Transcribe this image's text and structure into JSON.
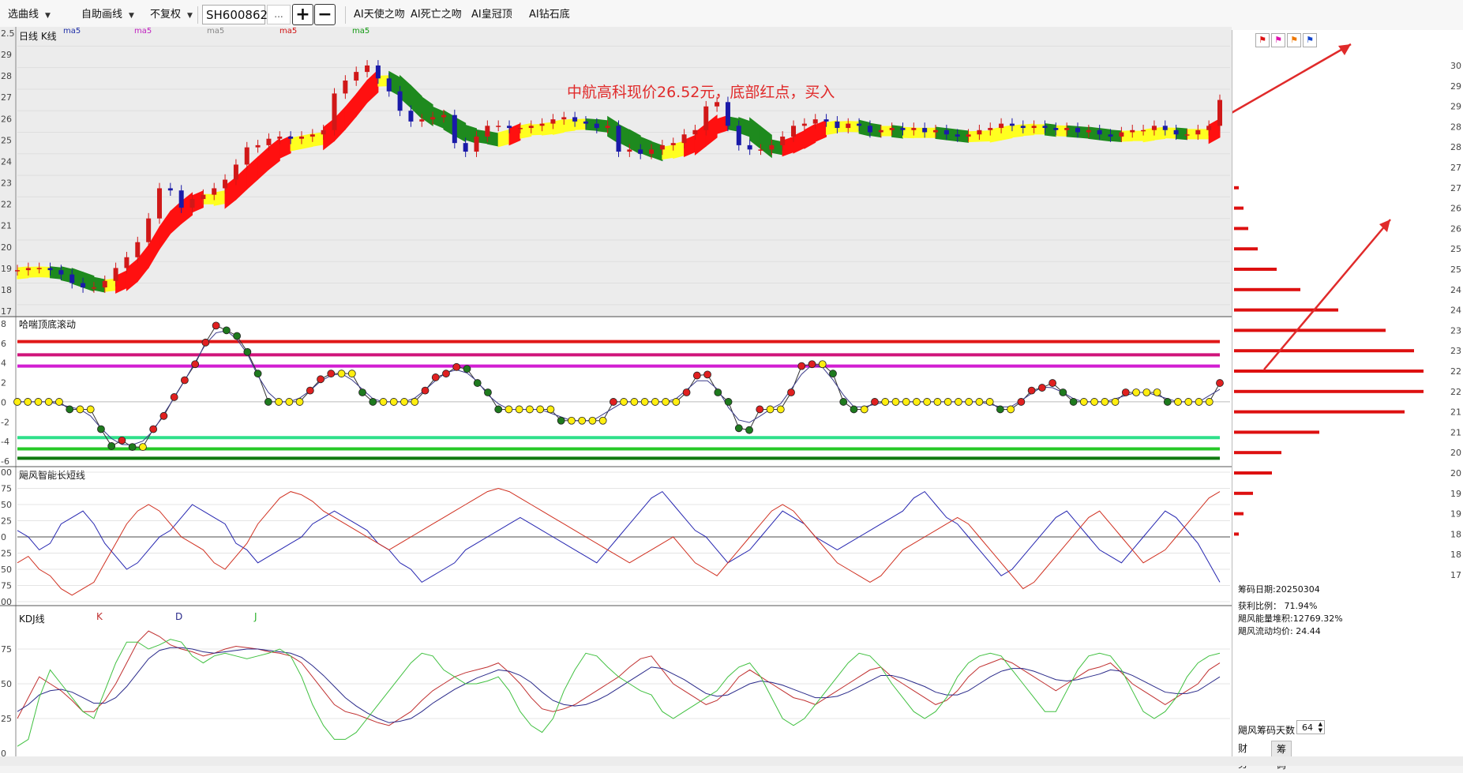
{
  "toolbar": {
    "draw_menu": "选曲线",
    "auto_draw": "自助画线",
    "adjust_mode": "不复权",
    "stock_code": "SH600862",
    "more": "...",
    "zoom_in": "+",
    "zoom_out": "−",
    "ai_buttons": [
      "AI天使之吻",
      "AI死亡之吻",
      "AI皇冠顶",
      "AI钻石底"
    ]
  },
  "annotation": "中航高科现价26.52元，底部红点，买入",
  "panels": {
    "kline": {
      "title": "日线 K线",
      "ma_labels": [
        {
          "text": "ma5",
          "color": "#1f2fa8"
        },
        {
          "text": "ma5",
          "color": "#c020c0"
        },
        {
          "text": "ma5",
          "color": "#888888"
        },
        {
          "text": "ma5",
          "color": "#d01010"
        },
        {
          "text": "ma5",
          "color": "#129a12"
        }
      ],
      "y_ticks": [
        "2.5",
        "29",
        "28",
        "27",
        "26",
        "25",
        "24",
        "23",
        "22",
        "21",
        "20",
        "19",
        "18",
        "17"
      ]
    },
    "hz": {
      "title": "哈喘顶底滚动",
      "y_ticks": [
        "8",
        "6",
        "4",
        "2",
        "0",
        "-2",
        "-4",
        "-6"
      ],
      "levels": [
        {
          "value": 6.4,
          "color": "#e01818"
        },
        {
          "value": 5.0,
          "color": "#d0147a"
        },
        {
          "value": 3.8,
          "color": "#d21ed2"
        },
        {
          "value": -3.8,
          "color": "#2fe08a"
        },
        {
          "value": -5.0,
          "color": "#27c827"
        },
        {
          "value": -6.0,
          "color": "#0f7a0f"
        }
      ]
    },
    "jf": {
      "title": "飓风智能长短线",
      "y_ticks": [
        "00",
        "75",
        "50",
        "25",
        "0",
        "25",
        "50",
        "75",
        "00"
      ]
    },
    "kdj": {
      "title": "KDJ线",
      "legend": [
        {
          "text": "K",
          "color": "#c03030"
        },
        {
          "text": "D",
          "color": "#2a2a8a"
        },
        {
          "text": "J",
          "color": "#28b028"
        }
      ],
      "y_ticks": [
        "75",
        "50",
        "25",
        "0"
      ]
    }
  },
  "chip": {
    "icons": [
      "flag-red-icon",
      "flag-pink-icon",
      "flag-orange-icon",
      "flag-blue-icon"
    ],
    "price_ticks": [
      "30",
      "29",
      "29",
      "28",
      "28",
      "27",
      "27",
      "26",
      "26",
      "25",
      "25",
      "24",
      "24",
      "23",
      "23",
      "22",
      "22",
      "21",
      "21",
      "20",
      "20",
      "19",
      "19",
      "18",
      "18",
      "17"
    ],
    "date_label": "筹码日期:20250304",
    "profit_label": "获利比例：",
    "profit_value": "71.94%",
    "energy_label": "飓风能量堆积:",
    "energy_value": "12769.32%",
    "avg_label": "飓风流动均价:",
    "avg_value": "24.44",
    "days_label": "飓风筹码天数",
    "days_value": "64",
    "tabs": [
      "财务",
      "筹码"
    ]
  },
  "chart_data": [
    {
      "type": "candlestick",
      "title": "日线 K线",
      "ylim": [
        16.7,
        29.6
      ],
      "x_count": 111,
      "close": [
        18.6,
        18.7,
        18.7,
        18.6,
        18.4,
        18.0,
        17.8,
        17.8,
        18.1,
        18.7,
        19.2,
        19.9,
        21.0,
        22.4,
        22.3,
        21.5,
        21.9,
        22.1,
        22.4,
        22.8,
        23.5,
        24.3,
        24.4,
        24.7,
        24.8,
        24.7,
        24.8,
        24.9,
        25.1,
        26.8,
        27.4,
        27.8,
        28.1,
        27.5,
        26.9,
        26.0,
        25.5,
        25.6,
        25.7,
        25.8,
        24.5,
        24.1,
        24.8,
        25.3,
        25.3,
        25.2,
        25.2,
        25.3,
        25.4,
        25.6,
        25.7,
        25.5,
        25.4,
        25.2,
        25.3,
        24.1,
        24.2,
        24.0,
        24.2,
        24.4,
        24.5,
        24.9,
        25.1,
        26.2,
        26.4,
        25.3,
        24.4,
        24.2,
        24.2,
        24.4,
        24.8,
        25.3,
        25.4,
        25.6,
        25.5,
        25.2,
        25.4,
        25.3,
        25.0,
        25.1,
        25.2,
        25.1,
        25.2,
        25.0,
        25.1,
        24.9,
        24.8,
        24.9,
        25.1,
        25.2,
        25.4,
        25.3,
        25.2,
        25.3,
        25.2,
        25.1,
        25.2,
        25.0,
        25.1,
        24.9,
        24.8,
        25.0,
        25.1,
        25.1,
        25.3,
        25.1,
        24.9,
        24.9,
        25.1,
        25.3,
        26.5
      ],
      "ma_band": "ma5 colored band (green=weak, yellow=neutral, red=strong)"
    },
    {
      "type": "line",
      "title": "哈喘顶底滚动",
      "ylim": [
        -6.3,
        8.3
      ],
      "series": [
        {
          "name": "",
          "values": [
            0,
            0,
            0,
            0,
            0,
            -0.8,
            -0.8,
            -0.8,
            -2.9,
            -4.7,
            -4.1,
            -4.8,
            -4.8,
            -2.9,
            -1.5,
            0.5,
            2.3,
            4.0,
            6.3,
            8.1,
            7.6,
            7.0,
            5.3,
            3.0,
            0,
            0,
            0,
            0,
            1.2,
            2.4,
            3.0,
            3.0,
            3.0,
            1.0,
            0,
            0,
            0,
            0,
            0,
            1.2,
            2.6,
            3.0,
            3.7,
            3.5,
            2.0,
            1.0,
            -0.8,
            -0.8,
            -0.8,
            -0.8,
            -0.8,
            -0.8,
            -2.0,
            -2.0,
            -2.0,
            -2.0,
            -2.0,
            0,
            0,
            0,
            0,
            0,
            0,
            0,
            1.0,
            2.8,
            2.9,
            1.0,
            0,
            -2.8,
            -3.0,
            -0.8,
            -0.8,
            -0.8,
            1.0,
            3.8,
            4.0,
            4.0,
            3.0,
            0,
            -0.8,
            -0.8,
            0,
            0,
            0,
            0,
            0,
            0,
            0,
            0,
            0,
            0,
            0,
            0,
            -0.8,
            -0.8,
            0,
            1.2,
            1.5,
            2.0,
            1.0,
            0,
            0,
            0,
            0,
            0,
            1.0,
            1.0,
            1.0,
            1.0,
            0,
            0,
            0,
            0,
            0,
            2.0
          ]
        }
      ]
    },
    {
      "type": "line",
      "title": "飓风智能长短线",
      "ylim": [
        -100,
        100
      ],
      "series": [
        {
          "name": "",
          "values": [
            10,
            0,
            -20,
            -10,
            20,
            30,
            40,
            20,
            -10,
            -30,
            -50,
            -40,
            -20,
            0,
            10,
            30,
            50,
            40,
            30,
            20,
            -10,
            -20,
            -40,
            -30,
            -20,
            -10,
            0,
            20,
            30,
            40,
            30,
            20,
            10,
            -10,
            -20,
            -40,
            -50,
            -70,
            -60,
            -50,
            -40,
            -20,
            -10,
            0,
            10,
            20,
            30,
            20,
            10,
            0,
            -10,
            -20,
            -30,
            -40,
            -20,
            0,
            20,
            40,
            60,
            70,
            50,
            30,
            10,
            0,
            -20,
            -40,
            -30,
            -20,
            0,
            20,
            40,
            30,
            20,
            0,
            -10,
            -20,
            -10,
            0,
            10,
            20,
            30,
            40,
            60,
            70,
            50,
            30,
            20,
            0,
            -20,
            -40,
            -60,
            -50,
            -30,
            -10,
            10,
            30,
            40,
            20,
            0,
            -20,
            -30,
            -40,
            -20,
            0,
            20,
            40,
            30,
            10,
            -10,
            -40,
            -70
          ]
        },
        {
          "name": "",
          "values": [
            -40,
            -30,
            -50,
            -60,
            -80,
            -90,
            -80,
            -70,
            -40,
            -10,
            20,
            40,
            50,
            40,
            20,
            0,
            -10,
            -20,
            -40,
            -50,
            -30,
            -10,
            20,
            40,
            60,
            70,
            65,
            55,
            40,
            30,
            20,
            10,
            0,
            -10,
            -20,
            -10,
            0,
            10,
            20,
            30,
            40,
            50,
            60,
            70,
            75,
            70,
            60,
            50,
            40,
            30,
            20,
            10,
            0,
            -10,
            -20,
            -30,
            -40,
            -30,
            -20,
            -10,
            0,
            -20,
            -40,
            -50,
            -60,
            -40,
            -20,
            0,
            20,
            40,
            50,
            40,
            20,
            0,
            -20,
            -40,
            -50,
            -60,
            -70,
            -60,
            -40,
            -20,
            -10,
            0,
            10,
            20,
            30,
            20,
            0,
            -20,
            -40,
            -60,
            -80,
            -70,
            -50,
            -30,
            -10,
            10,
            30,
            40,
            20,
            0,
            -20,
            -40,
            -30,
            -20,
            0,
            20,
            40,
            60,
            70
          ]
        }
      ]
    },
    {
      "type": "line",
      "title": "KDJ线",
      "ylim": [
        0,
        100
      ],
      "series": [
        {
          "name": "K",
          "values": [
            25,
            40,
            55,
            50,
            45,
            38,
            30,
            30,
            38,
            50,
            65,
            80,
            88,
            84,
            78,
            75,
            73,
            70,
            72,
            75,
            77,
            76,
            75,
            73,
            72,
            70,
            65,
            55,
            45,
            35,
            30,
            28,
            25,
            22,
            20,
            25,
            30,
            38,
            45,
            50,
            55,
            58,
            60,
            62,
            65,
            58,
            50,
            40,
            32,
            30,
            32,
            35,
            40,
            45,
            50,
            55,
            62,
            68,
            70,
            60,
            50,
            45,
            40,
            35,
            38,
            45,
            55,
            60,
            55,
            50,
            45,
            40,
            38,
            35,
            40,
            45,
            50,
            55,
            60,
            62,
            55,
            50,
            45,
            40,
            35,
            38,
            45,
            55,
            62,
            65,
            68,
            65,
            60,
            55,
            50,
            45,
            50,
            55,
            60,
            62,
            65,
            58,
            50,
            45,
            40,
            35,
            40,
            45,
            50,
            60,
            65
          ]
        },
        {
          "name": "D",
          "values": [
            30,
            35,
            42,
            45,
            46,
            44,
            40,
            36,
            36,
            40,
            48,
            58,
            68,
            74,
            76,
            76,
            75,
            73,
            72,
            73,
            74,
            75,
            75,
            74,
            73,
            72,
            69,
            63,
            56,
            48,
            40,
            34,
            29,
            25,
            22,
            23,
            25,
            30,
            36,
            41,
            46,
            50,
            54,
            57,
            60,
            59,
            56,
            51,
            44,
            38,
            35,
            34,
            35,
            38,
            42,
            47,
            52,
            57,
            62,
            61,
            57,
            53,
            48,
            43,
            41,
            42,
            46,
            50,
            52,
            51,
            49,
            46,
            43,
            40,
            40,
            41,
            44,
            48,
            52,
            56,
            56,
            54,
            51,
            48,
            44,
            42,
            42,
            45,
            50,
            55,
            59,
            61,
            61,
            59,
            56,
            53,
            52,
            53,
            55,
            57,
            60,
            59,
            56,
            52,
            48,
            44,
            43,
            43,
            45,
            50,
            55
          ]
        },
        {
          "name": "J",
          "values": [
            5,
            10,
            40,
            60,
            50,
            40,
            30,
            25,
            45,
            65,
            80,
            80,
            75,
            78,
            82,
            80,
            70,
            65,
            70,
            72,
            70,
            68,
            70,
            72,
            75,
            70,
            55,
            35,
            20,
            10,
            10,
            15,
            25,
            35,
            45,
            55,
            65,
            72,
            70,
            60,
            55,
            50,
            50,
            52,
            55,
            45,
            30,
            20,
            15,
            25,
            45,
            60,
            72,
            70,
            62,
            55,
            50,
            45,
            42,
            30,
            25,
            30,
            35,
            40,
            45,
            55,
            62,
            65,
            55,
            40,
            25,
            20,
            25,
            35,
            45,
            55,
            65,
            72,
            70,
            62,
            50,
            40,
            30,
            25,
            30,
            40,
            55,
            65,
            70,
            72,
            70,
            60,
            50,
            40,
            30,
            30,
            45,
            60,
            70,
            72,
            70,
            60,
            45,
            30,
            25,
            30,
            40,
            55,
            65,
            70,
            72
          ]
        }
      ]
    },
    {
      "type": "bar",
      "title": "",
      "orientation": "horizontal",
      "categories": [
        "30",
        "29",
        "29",
        "28",
        "28",
        "27",
        "27",
        "26",
        "26",
        "25",
        "25",
        "24",
        "24",
        "23",
        "23",
        "22",
        "22",
        "21",
        "21",
        "20",
        "20",
        "19",
        "19",
        "18",
        "18",
        "17"
      ],
      "values": [
        0,
        0,
        0,
        0,
        0,
        0,
        1,
        2,
        3,
        5,
        9,
        14,
        22,
        32,
        38,
        40,
        40,
        36,
        18,
        10,
        8,
        4,
        2,
        1,
        0,
        0
      ]
    }
  ]
}
